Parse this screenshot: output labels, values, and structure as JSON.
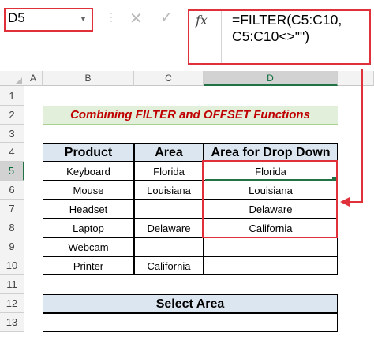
{
  "name_box": {
    "value": "D5"
  },
  "formula_bar": {
    "fx_label": "fx",
    "formula": "=FILTER(C5:C10,\nC5:C10<>\"\")"
  },
  "columns": [
    "A",
    "B",
    "C",
    "D"
  ],
  "rows": [
    "1",
    "2",
    "3",
    "4",
    "5",
    "6",
    "7",
    "8",
    "9",
    "10",
    "11",
    "12",
    "13"
  ],
  "sheet": {
    "title": "Combining FILTER and OFFSET Functions",
    "headers": [
      "Product",
      "Area",
      "Area for Drop Down"
    ],
    "data": [
      [
        "Keyboard",
        "Florida",
        "Florida"
      ],
      [
        "Mouse",
        "Louisiana",
        "Louisiana"
      ],
      [
        "Headset",
        "",
        "Delaware"
      ],
      [
        "Laptop",
        "Delaware",
        "California"
      ],
      [
        "Webcam",
        "",
        ""
      ],
      [
        "Printer",
        "California",
        ""
      ]
    ],
    "select_area_label": "Select Area"
  },
  "colors": {
    "accent_red": "#e0303a",
    "excel_green": "#217346",
    "title_fill": "#e2efda",
    "header_fill": "#dce6f1"
  }
}
